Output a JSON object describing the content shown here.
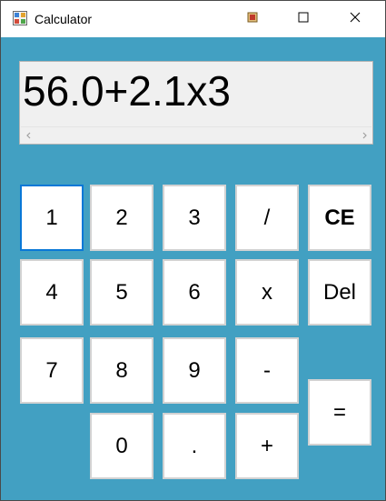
{
  "window": {
    "title": "Calculator",
    "icon": "calculator-app-icon",
    "controls": [
      "minimize-icon",
      "maximize-icon",
      "close-icon"
    ]
  },
  "display": {
    "value": "56.0+2.1x3"
  },
  "keys": {
    "k1": "1",
    "k2": "2",
    "k3": "3",
    "div": "/",
    "ce": "CE",
    "k4": "4",
    "k5": "5",
    "k6": "6",
    "mul": "x",
    "del": "Del",
    "k7": "7",
    "k8": "8",
    "k9": "9",
    "sub": "-",
    "k0": "0",
    "dot": ".",
    "add": "+",
    "eq": "="
  },
  "colors": {
    "client_background": "#42a0c2",
    "focus_border": "#0a78d7"
  }
}
